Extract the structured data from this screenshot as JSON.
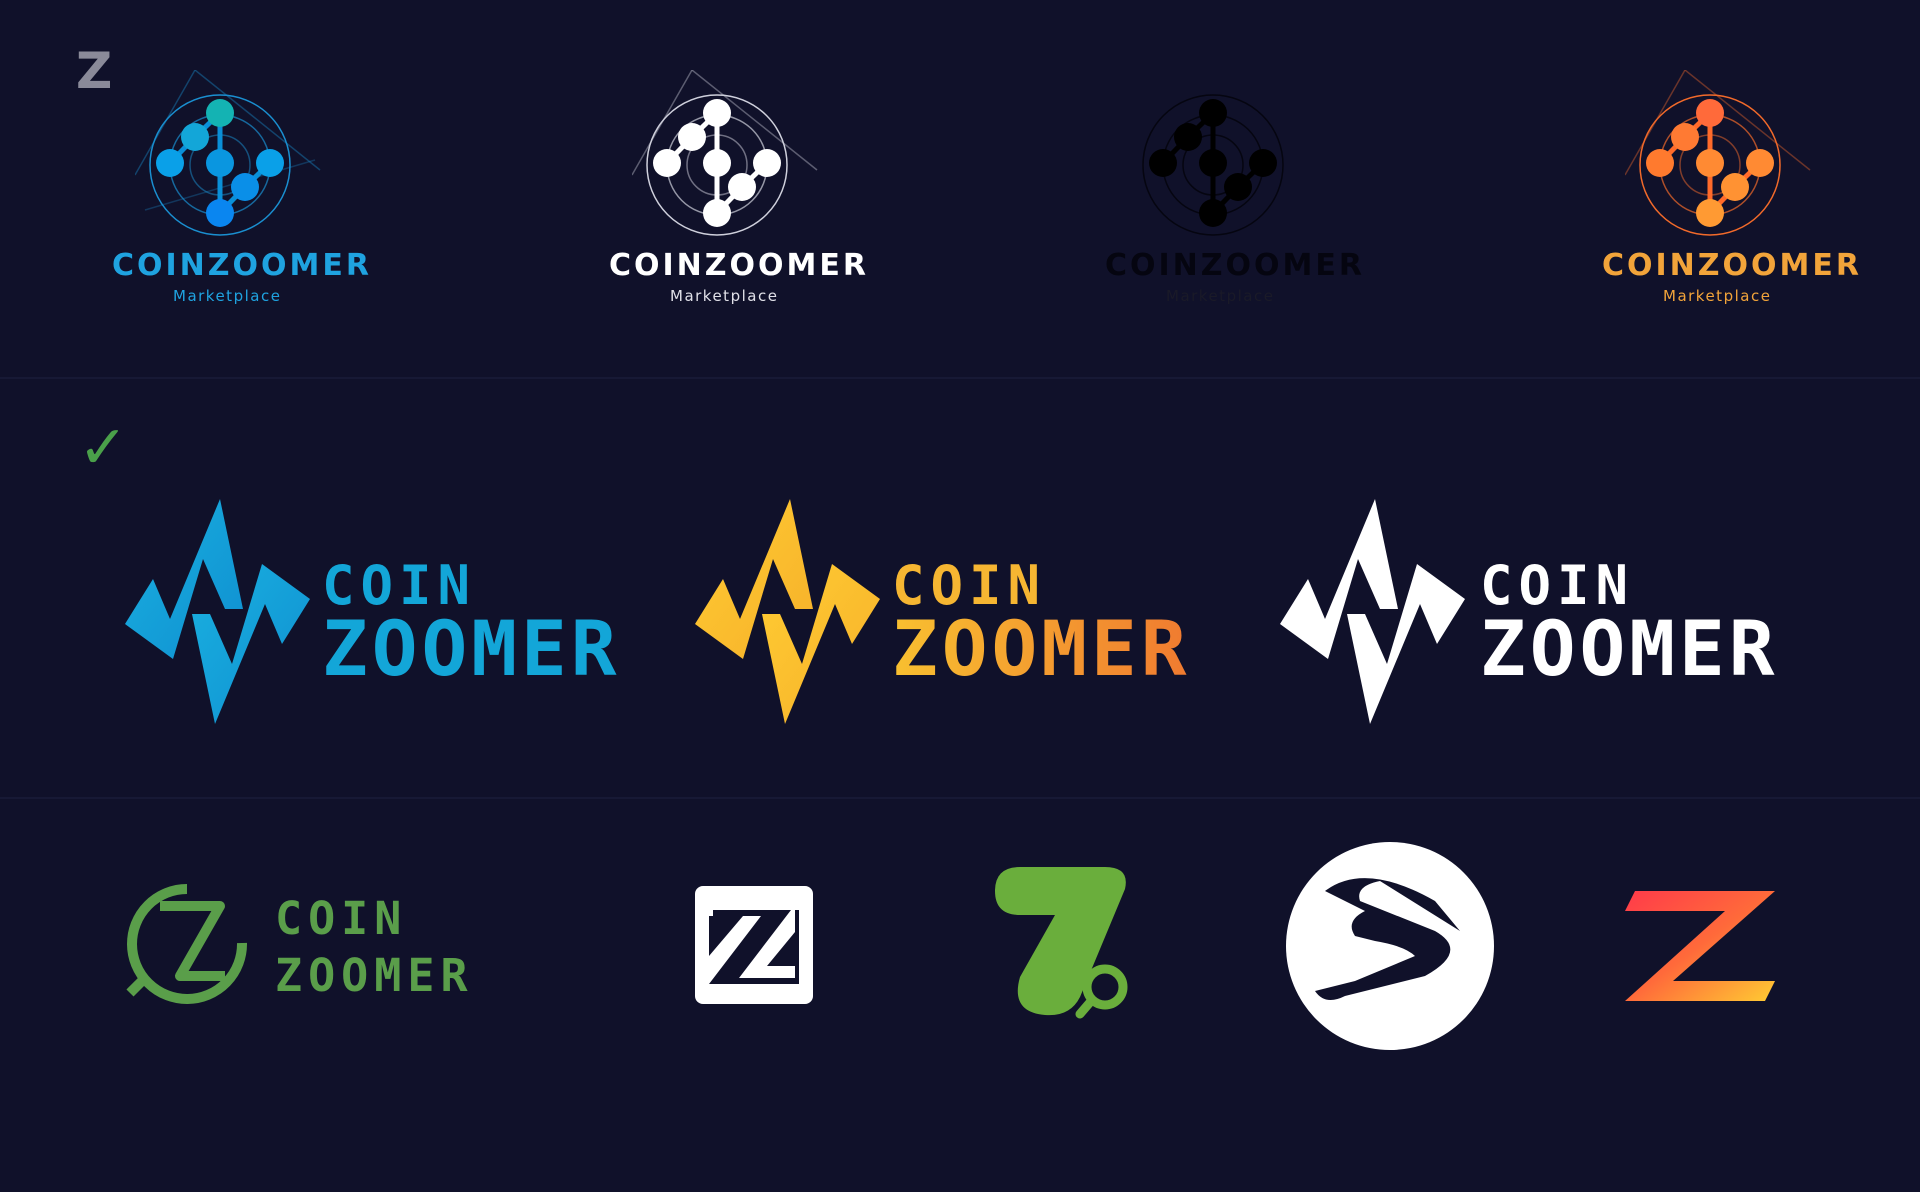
{
  "markers": {
    "row1": "Z",
    "row2": "✓"
  },
  "row1": {
    "logos": [
      {
        "word": "COINZOOMER",
        "sub": "Marketplace",
        "word_color": "#1fa3e0",
        "sub_color": "#1fa3e0",
        "node_color": "#0aa0e8",
        "ring_color": "#1a8fd0"
      },
      {
        "word": "COINZOOMER",
        "sub": "Marketplace",
        "word_color": "#ffffff",
        "sub_color": "#e0e0e8",
        "node_color": "#ffffff",
        "ring_color": "#cfd0dc"
      },
      {
        "word": "COINZOOMER",
        "sub": "Marketplace",
        "word_color": "#050510",
        "sub_color": "#1a1a28",
        "node_color": "#000000",
        "ring_color": "#050510"
      },
      {
        "word": "COINZOOMER",
        "sub": "Marketplace",
        "word_color": "#f2a43a",
        "sub_color": "#f2a43a",
        "node_color": "#ff7a33",
        "ring_color": "#f26a2a"
      }
    ]
  },
  "row2": {
    "logos": [
      {
        "line1": "COIN",
        "line2": "ZOOMER",
        "color": "#13a6d8"
      },
      {
        "line1": "COIN",
        "line2": "ZOOMER",
        "color": "#f6b632"
      },
      {
        "line1": "COIN",
        "line2": "ZOOMER",
        "color": "#ffffff"
      }
    ]
  },
  "row3": {
    "green_wordmark": {
      "line1": "COIN",
      "line2": "ZOOMER",
      "color": "#5a9e4a"
    },
    "colors": {
      "green": "#5a9e4a",
      "bright_green": "#6aae3c",
      "white": "#ffffff"
    }
  }
}
